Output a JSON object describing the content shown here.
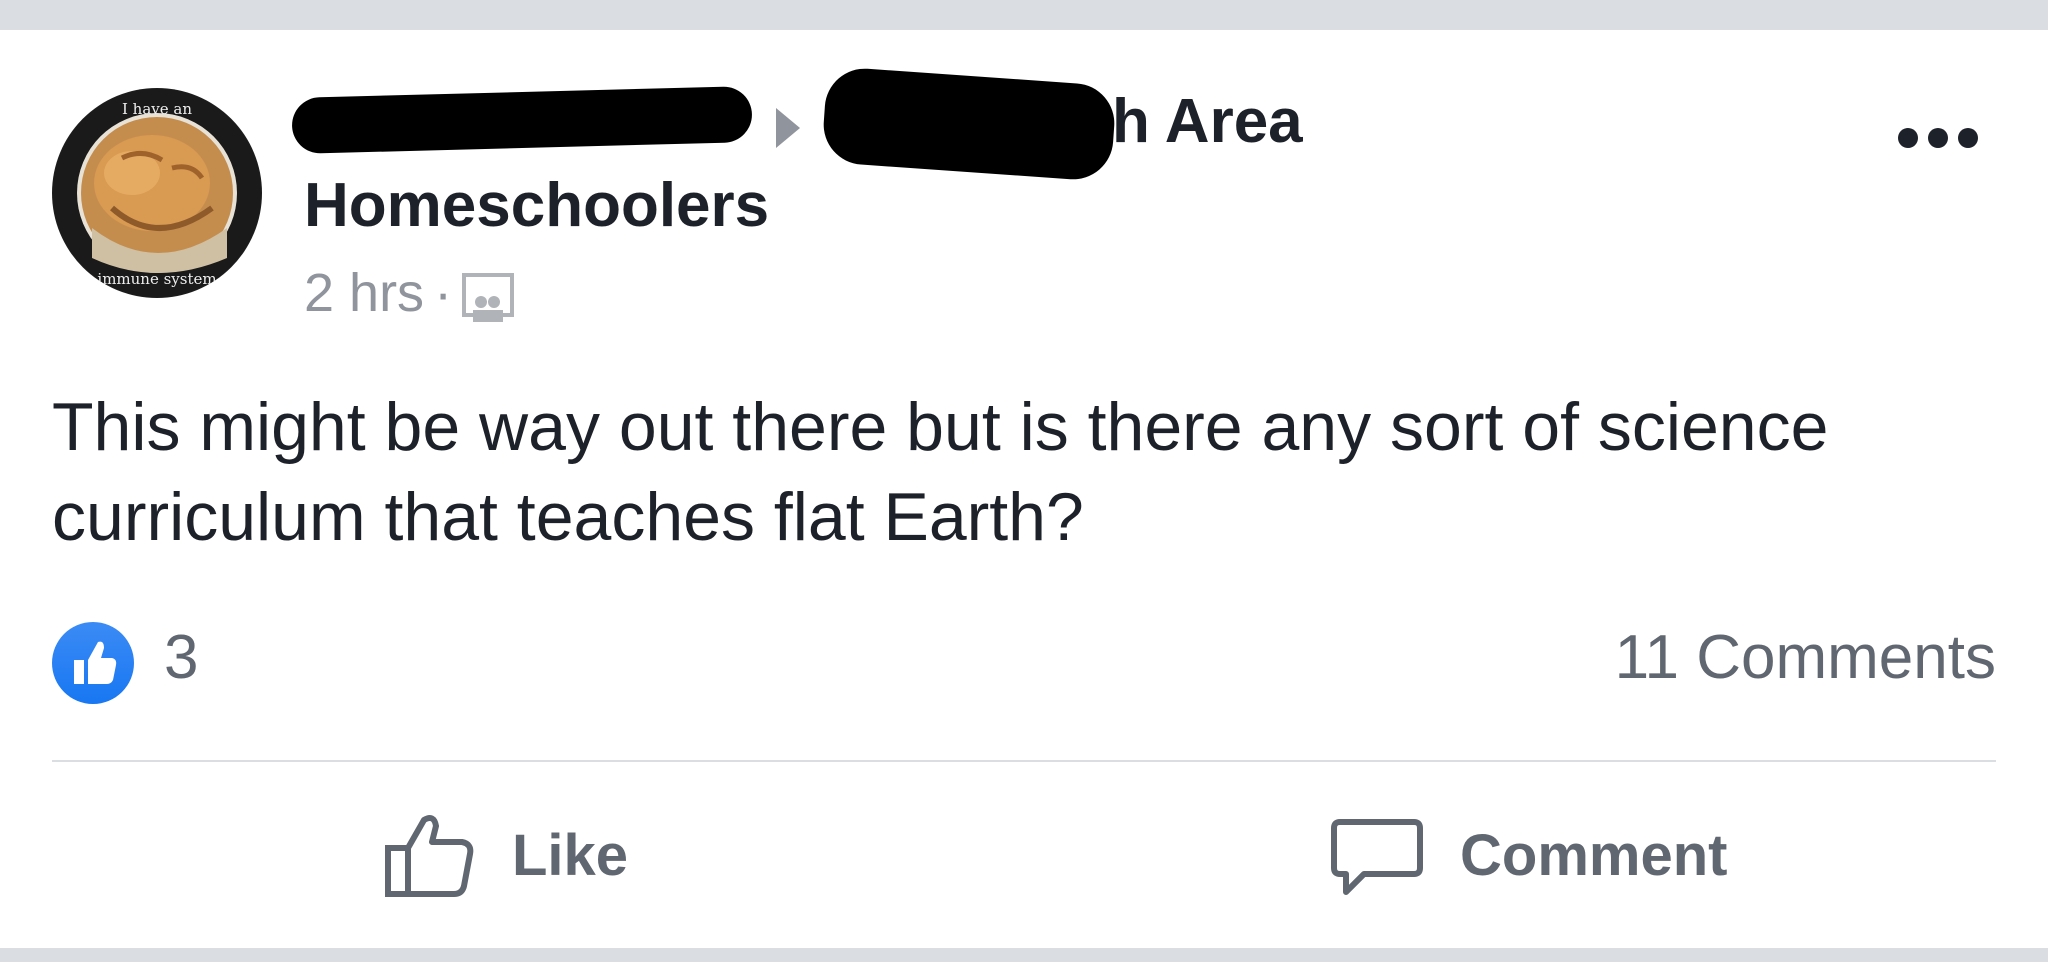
{
  "post": {
    "group_area_fragment": "h Area",
    "group_name": "Homeschoolers",
    "time": "2 hrs",
    "separator": "·",
    "privacy_icon": "group-icon",
    "body": "This might be way out there but is there any sort of science curriculum that teaches flat Earth?",
    "avatar_ring_text_top": "I have an",
    "avatar_ring_text_bottom": "immune system"
  },
  "stats": {
    "like_count": "3",
    "comments": "11 Comments"
  },
  "actions": {
    "like_label": "Like",
    "comment_label": "Comment"
  },
  "colors": {
    "background": "#dadde2",
    "text": "#1d2129",
    "secondary": "#606770",
    "like_blue": "#1877f2"
  }
}
